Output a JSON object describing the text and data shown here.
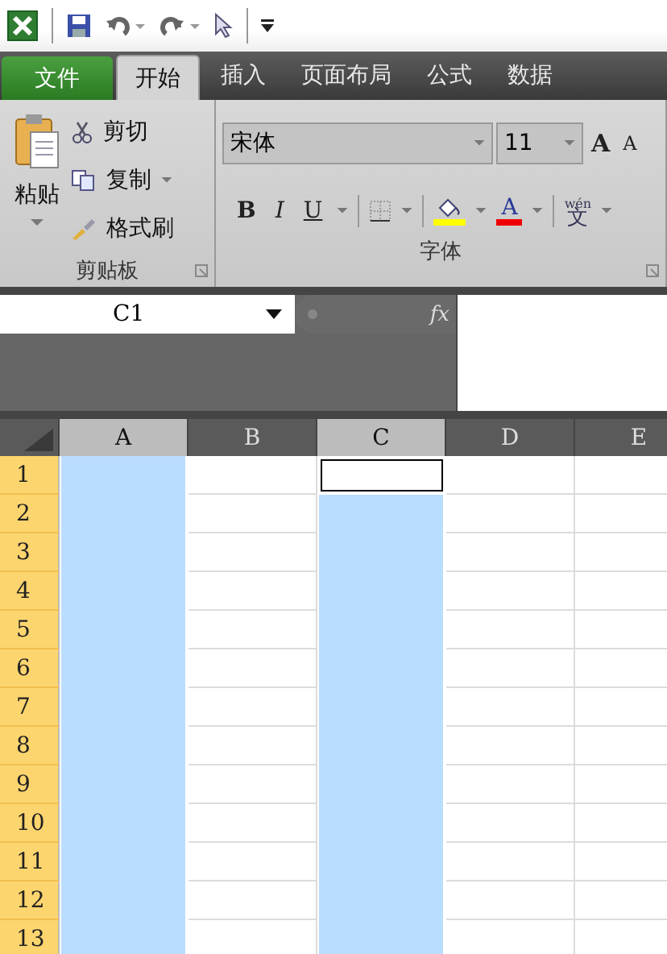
{
  "tabs": [
    {
      "label": "文件",
      "kind": "file",
      "selected": false
    },
    {
      "label": "开始",
      "kind": "tab",
      "selected": true
    },
    {
      "label": "插入",
      "kind": "tab",
      "selected": false
    },
    {
      "label": "页面布局",
      "kind": "tab",
      "selected": false
    },
    {
      "label": "公式",
      "kind": "tab",
      "selected": false
    },
    {
      "label": "数据",
      "kind": "tab",
      "selected": false
    }
  ],
  "clipboard": {
    "paste": "粘贴",
    "cut": "剪切",
    "copy": "复制",
    "format_painter": "格式刷",
    "group_label": "剪贴板"
  },
  "font": {
    "font_name": "宋体",
    "font_size": "11",
    "grow": "A",
    "shrink": "A",
    "bold": "B",
    "italic": "I",
    "underline": "U",
    "font_color": "A",
    "phonetic_top": "wén",
    "phonetic": "文",
    "group_label": "字体"
  },
  "formula_bar": {
    "name_box": "C1",
    "fx": "fx"
  },
  "columns": [
    {
      "label": "A",
      "selected": true,
      "active": false
    },
    {
      "label": "B",
      "selected": false,
      "active": false
    },
    {
      "label": "C",
      "selected": true,
      "active": true
    },
    {
      "label": "D",
      "selected": false,
      "active": false
    },
    {
      "label": "E",
      "selected": false,
      "active": false
    }
  ],
  "rows": [
    {
      "label": "1",
      "selected": true,
      "active": true
    },
    {
      "label": "2",
      "selected": true,
      "active": false
    },
    {
      "label": "3",
      "selected": true,
      "active": false
    },
    {
      "label": "4",
      "selected": true,
      "active": false
    },
    {
      "label": "5",
      "selected": true,
      "active": false
    },
    {
      "label": "6",
      "selected": true,
      "active": false
    },
    {
      "label": "7",
      "selected": true,
      "active": false
    },
    {
      "label": "8",
      "selected": true,
      "active": false
    },
    {
      "label": "9",
      "selected": true,
      "active": false
    },
    {
      "label": "10",
      "selected": true,
      "active": false
    },
    {
      "label": "11",
      "selected": true,
      "active": false
    },
    {
      "label": "12",
      "selected": true,
      "active": false
    },
    {
      "label": "13",
      "selected": true,
      "active": false
    }
  ]
}
